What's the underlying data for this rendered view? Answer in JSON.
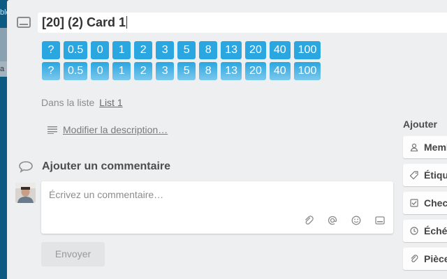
{
  "card": {
    "title": "[20] (2) Card 1"
  },
  "planning_poker": {
    "row1": [
      "?",
      "0.5",
      "0",
      "1",
      "2",
      "3",
      "5",
      "8",
      "13",
      "20",
      "40",
      "100"
    ],
    "row2": [
      "?",
      "0.5",
      "0",
      "1",
      "2",
      "3",
      "5",
      "8",
      "13",
      "20",
      "40",
      "100"
    ],
    "colors": {
      "accent": "#2aa6e0",
      "faded": "#7cc8ec"
    }
  },
  "list_info": {
    "prefix": "Dans la liste",
    "list_name": "List 1"
  },
  "description": {
    "link_label": "Modifier la description…"
  },
  "comment": {
    "heading": "Ajouter un commentaire",
    "placeholder": "Écrivez un commentaire…",
    "send_label": "Envoyer"
  },
  "sidebar": {
    "heading": "Ajouter",
    "buttons": [
      {
        "label": "Membres",
        "icon": "person-icon"
      },
      {
        "label": "Étiquettes",
        "icon": "tag-icon"
      },
      {
        "label": "Checklist",
        "icon": "checkbox-icon"
      },
      {
        "label": "Échéance",
        "icon": "clock-icon"
      },
      {
        "label": "Pièce jointe",
        "icon": "paperclip-icon"
      }
    ]
  },
  "background": {
    "peek_text": "ble",
    "peek_card_text": "a"
  }
}
